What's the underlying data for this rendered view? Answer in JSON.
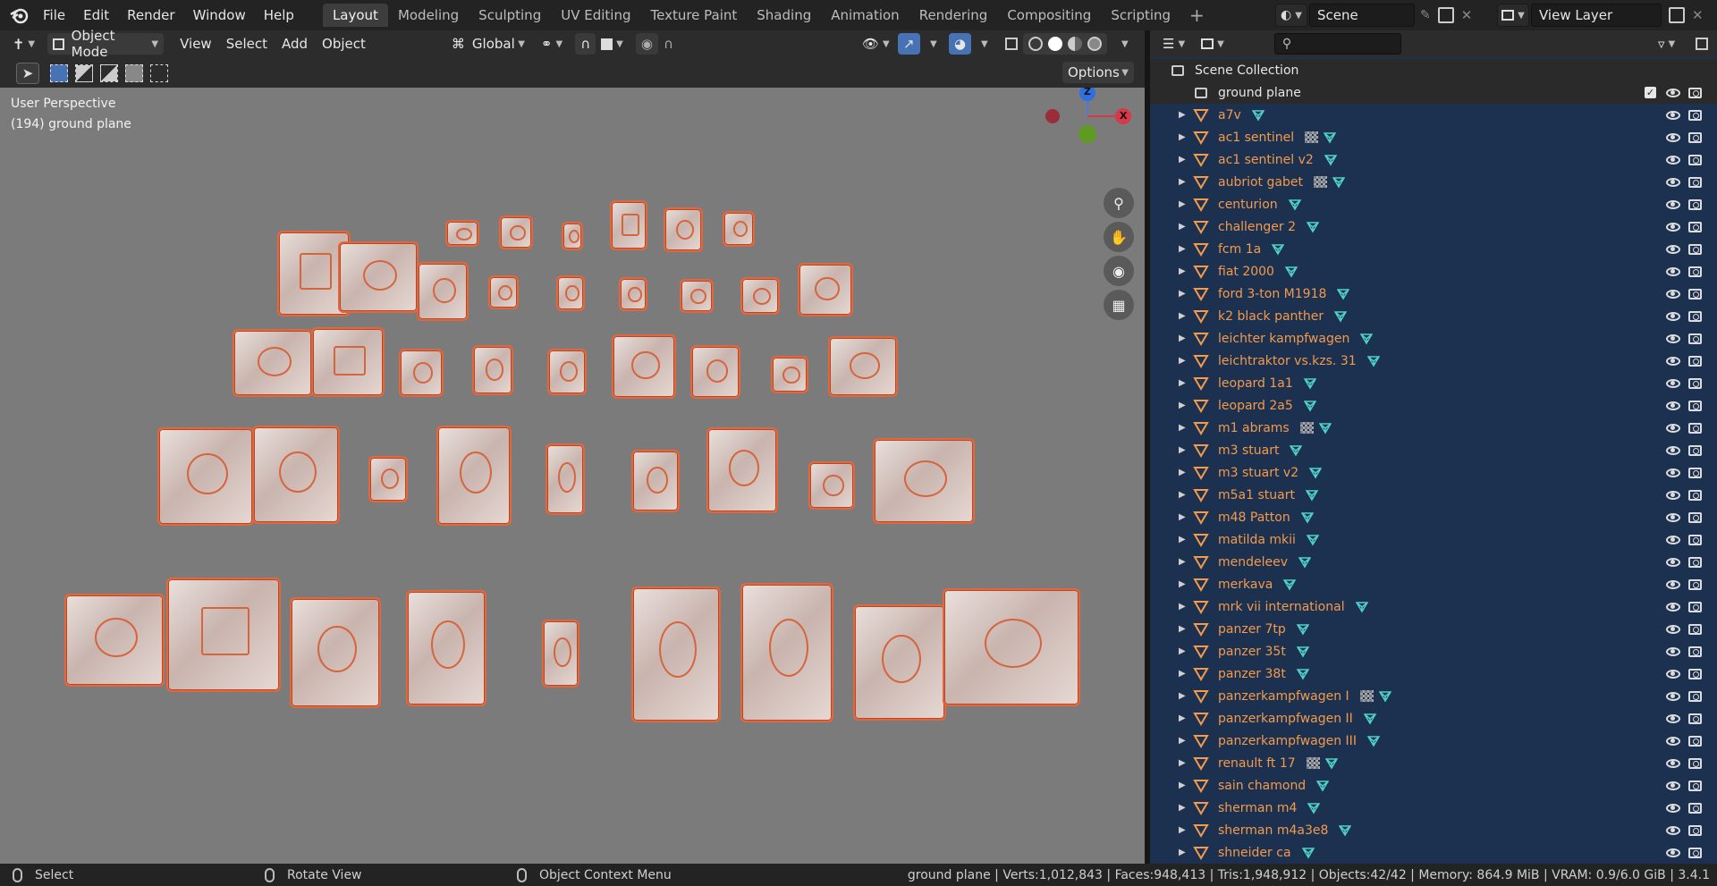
{
  "topbar": {
    "menus": [
      "File",
      "Edit",
      "Render",
      "Window",
      "Help"
    ],
    "workspaces": [
      "Layout",
      "Modeling",
      "Sculpting",
      "UV Editing",
      "Texture Paint",
      "Shading",
      "Animation",
      "Rendering",
      "Compositing",
      "Scripting"
    ],
    "active_workspace": "Layout",
    "add_tab": "+",
    "scene_name": "Scene",
    "view_layer": "View Layer"
  },
  "viewport_header": {
    "mode": "Object Mode",
    "menus": [
      "View",
      "Select",
      "Add",
      "Object"
    ],
    "transform_orientation": "Global",
    "options_label": "Options"
  },
  "viewport": {
    "perspective_label": "User Perspective",
    "active_object_label": "(194) ground plane",
    "gizmo": {
      "z": "Z",
      "x": "X"
    }
  },
  "outliner": {
    "search_placeholder": "",
    "scene_collection": "Scene Collection",
    "ground_plane": "ground plane",
    "objects": [
      {
        "name": "a7v",
        "grid": false
      },
      {
        "name": "ac1 sentinel",
        "grid": true
      },
      {
        "name": "ac1 sentinel v2",
        "grid": false
      },
      {
        "name": "aubriot gabet",
        "grid": true
      },
      {
        "name": "centurion",
        "grid": false
      },
      {
        "name": "challenger 2",
        "grid": false
      },
      {
        "name": "fcm 1a",
        "grid": false
      },
      {
        "name": "fiat 2000",
        "grid": false
      },
      {
        "name": "ford 3-ton M1918",
        "grid": false
      },
      {
        "name": "k2 black panther",
        "grid": false
      },
      {
        "name": "leichter kampfwagen",
        "grid": false
      },
      {
        "name": "leichtraktor vs.kzs. 31",
        "grid": false
      },
      {
        "name": "leopard 1a1",
        "grid": false
      },
      {
        "name": "leopard 2a5",
        "grid": false
      },
      {
        "name": "m1 abrams",
        "grid": true
      },
      {
        "name": "m3 stuart",
        "grid": false
      },
      {
        "name": "m3 stuart v2",
        "grid": false
      },
      {
        "name": "m5a1 stuart",
        "grid": false
      },
      {
        "name": "m48 Patton",
        "grid": false
      },
      {
        "name": "matilda mkii",
        "grid": false
      },
      {
        "name": "mendeleev",
        "grid": false
      },
      {
        "name": "merkava",
        "grid": false
      },
      {
        "name": "mrk vii international",
        "grid": false
      },
      {
        "name": "panzer 7tp",
        "grid": false
      },
      {
        "name": "panzer 35t",
        "grid": false
      },
      {
        "name": "panzer 38t",
        "grid": false
      },
      {
        "name": "panzerkampfwagen I",
        "grid": true
      },
      {
        "name": "panzerkampfwagen II",
        "grid": false
      },
      {
        "name": "panzerkampfwagen III",
        "grid": false
      },
      {
        "name": "renault ft 17",
        "grid": true
      },
      {
        "name": "sain chamond",
        "grid": false
      },
      {
        "name": "sherman m4",
        "grid": false
      },
      {
        "name": "sherman m4a3e8",
        "grid": false
      },
      {
        "name": "shneider ca",
        "grid": false
      }
    ]
  },
  "statusbar": {
    "select": "Select",
    "rotate": "Rotate View",
    "context_menu": "Object Context Menu",
    "stats": "ground plane | Verts:1,012,843 | Faces:948,413 | Tris:1,948,912 | Objects:42/42 | Memory: 864.9 MiB | VRAM: 0.9/6.0 GiB | 3.4.1"
  },
  "colors": {
    "outliner_selected_bg": "#1c3150",
    "object_label": "#f39a4c",
    "viewport_bg": "#7b7b7b",
    "selection_outline": "#e4663c",
    "accent_blue": "#4772b3"
  }
}
